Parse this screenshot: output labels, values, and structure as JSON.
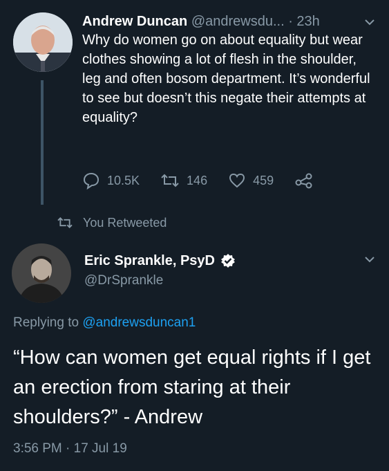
{
  "tweet1": {
    "name": "Andrew Duncan",
    "handle": "@andrewsdu...",
    "time": "· 23h",
    "text": "Why do women go on about equality but wear clothes showing a lot of flesh in the shoulder, leg and often bosom department. It’s wonderful to see but doesn’t this negate their attempts at equality?",
    "stats": {
      "replies": "10.5K",
      "retweets": "146",
      "likes": "459"
    },
    "icons": {
      "reply": "reply-icon",
      "retweet": "retweet-icon",
      "like": "heart-icon",
      "share": "share-icon",
      "menu": "chevron-down-icon"
    }
  },
  "retweet_indicator": {
    "label": "You Retweeted"
  },
  "tweet2": {
    "name": "Eric Sprankle, PsyD",
    "handle": "@DrSprankle",
    "reply_prefix": "Replying to",
    "reply_to": "@andrewsduncan1",
    "text": "“How can women get equal rights if I get an erection from staring at their shoulders?” - Andrew",
    "timestamp": "3:56 PM · 17 Jul 19"
  },
  "colors": {
    "background": "#141d26",
    "text": "#ffffff",
    "muted": "#8899a6",
    "accent": "#1da1f2",
    "thread_line": "#3d5466"
  }
}
